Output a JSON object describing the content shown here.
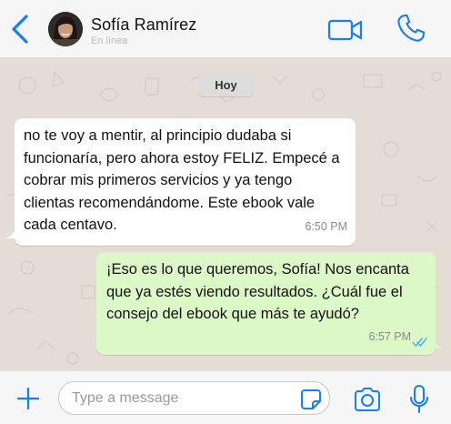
{
  "contact": {
    "name": "Sofía Ramírez",
    "status": "En línea"
  },
  "chat": {
    "date_chip": "Hoy",
    "messages": [
      {
        "direction": "incoming",
        "text": "no te voy a mentir, al principio dudaba si funcionaría, pero ahora estoy FELIZ. Empecé a cobrar mis primeros servicios y ya tengo clientas recomendándome. Este ebook vale cada centavo.",
        "time": "6:50 PM"
      },
      {
        "direction": "outgoing",
        "text": "¡Eso es lo que queremos, Sofía! Nos encanta que ya estés viendo resultados. ¿Cuál fue el consejo del ebook que más te ayudó?",
        "time": "6:57 PM",
        "status": "read"
      }
    ]
  },
  "composer": {
    "placeholder": "Type a message"
  },
  "icons": {
    "back": "chevron-left-icon",
    "video": "video-camera-icon",
    "call": "phone-icon",
    "attach": "plus-icon",
    "sticker": "sticker-icon",
    "camera": "camera-icon",
    "mic": "microphone-icon",
    "read": "double-check-icon"
  },
  "colors": {
    "accent": "#147efb",
    "incoming_bubble": "#ffffff",
    "outgoing_bubble": "#dcf8c6",
    "chat_background": "#e5ddd5",
    "read_ticks": "#4fb6ec"
  }
}
